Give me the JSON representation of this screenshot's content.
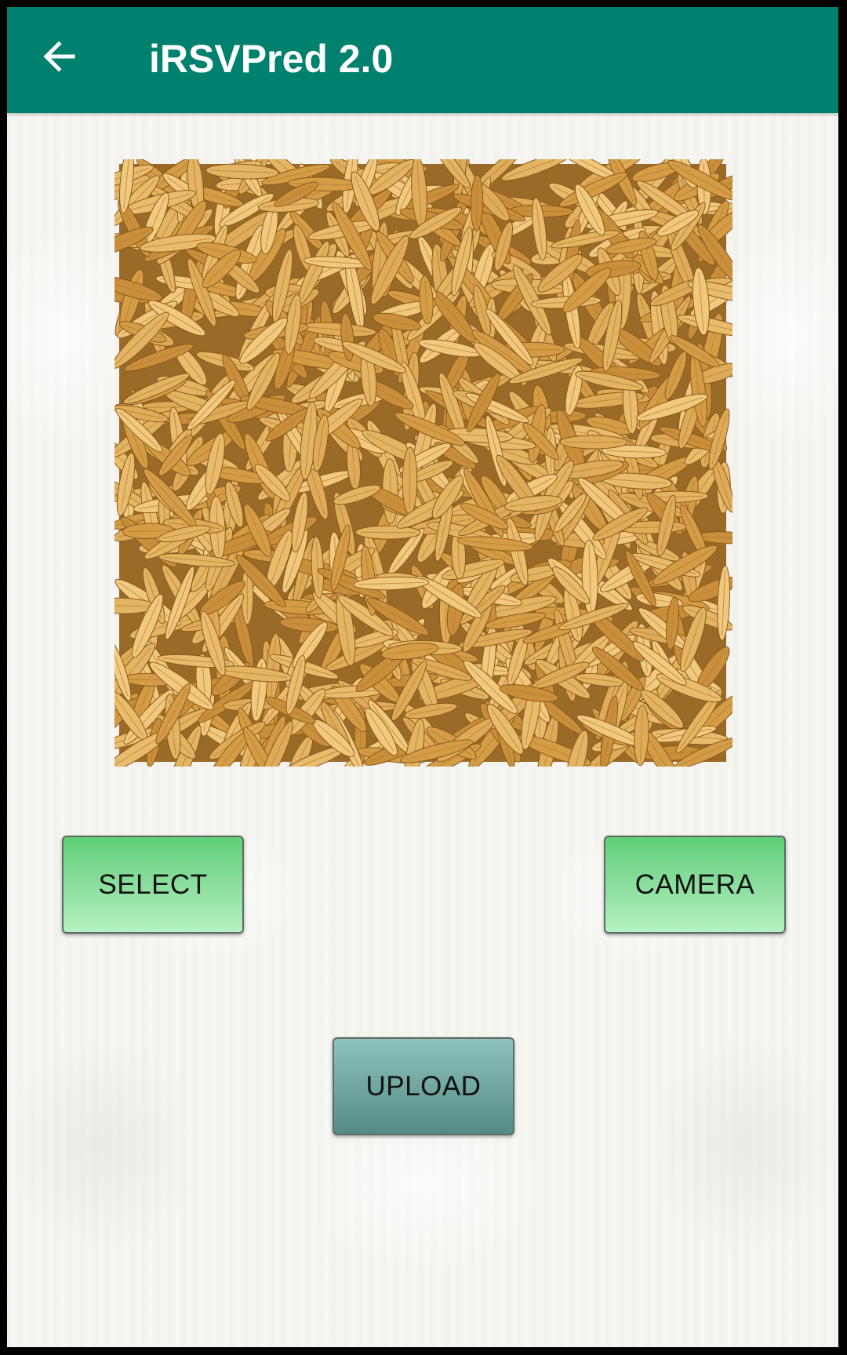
{
  "app_bar": {
    "title": "iRSVPred 2.0",
    "back_icon": "arrow-back-icon",
    "background_color": "#00806e"
  },
  "preview": {
    "content": "rice-grains-photo"
  },
  "buttons": {
    "select_label": "SELECT",
    "camera_label": "CAMERA",
    "upload_label": "UPLOAD",
    "select_color": "#8fe0a0",
    "camera_color": "#8fe0a0",
    "upload_color": "#6fa59e"
  }
}
